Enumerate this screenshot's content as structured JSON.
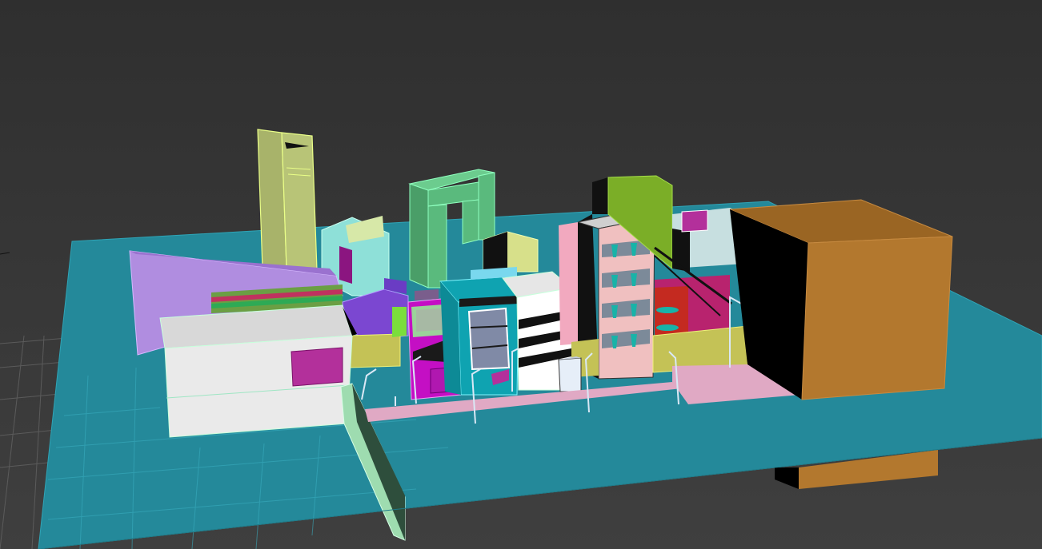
{
  "viewport": {
    "kind": "3d-perspective-viewport",
    "colors": {
      "background": "#3a3a3a",
      "ground_plane": "#24899a",
      "grid_lines": "#5a5a5a",
      "wireframe_edge": "#c8ffdc"
    }
  },
  "scene_objects": [
    {
      "name": "tall-tower-yellow",
      "color": "#b4bf73"
    },
    {
      "name": "arch-gate-green",
      "color": "#5aba7d"
    },
    {
      "name": "purple-wedge",
      "color": "#b08de0"
    },
    {
      "name": "white-block-front-left",
      "color": "#e8e8e8"
    },
    {
      "name": "teal-tower",
      "color": "#0fa3b1"
    },
    {
      "name": "magenta-building",
      "color": "#c40fc4"
    },
    {
      "name": "striped-facade-building",
      "color": "#ffffff"
    },
    {
      "name": "pink-apartment-tower",
      "color": "#f0c0c0"
    },
    {
      "name": "green-cube-top",
      "color": "#7bae27"
    },
    {
      "name": "crimson-building",
      "color": "#b8236e"
    },
    {
      "name": "orange-cube-large",
      "color": "#b3782e"
    },
    {
      "name": "yellow-olive-wall",
      "color": "#c4c256"
    },
    {
      "name": "mint-signpost-beam",
      "color": "#9edcb0"
    }
  ]
}
